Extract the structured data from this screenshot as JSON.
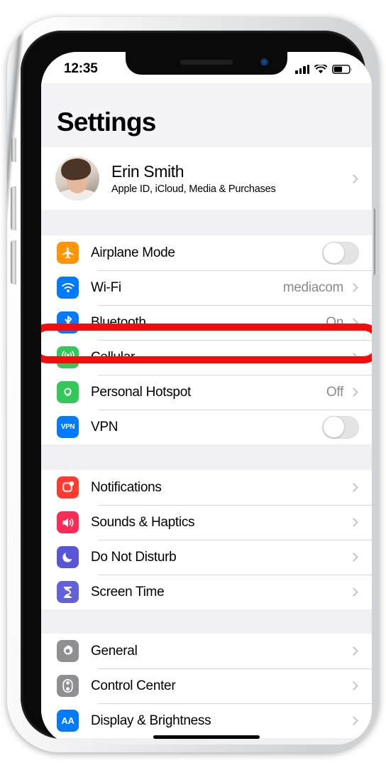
{
  "status_bar": {
    "time": "12:35",
    "signal_icon": "cellular-bars-icon",
    "wifi_icon": "wifi-icon",
    "battery_icon": "battery-icon",
    "battery_level_pct": 52
  },
  "header": {
    "title": "Settings"
  },
  "account": {
    "name": "Erin Smith",
    "subtitle": "Apple ID, iCloud, Media & Purchases",
    "avatar_icon": "avatar",
    "chevron_icon": "chevron-right-icon"
  },
  "annotation": {
    "target": "wifi-row",
    "shape": "oval",
    "color": "#f40c0c"
  },
  "groups": [
    {
      "id": "connectivity",
      "rows": [
        {
          "id": "airplane-mode",
          "label": "Airplane Mode",
          "icon": "airplane-icon",
          "icon_color": "#ff9500",
          "accessory": "toggle",
          "toggle_on": false
        },
        {
          "id": "wifi",
          "label": "Wi-Fi",
          "icon": "wifi-icon",
          "icon_color": "#007aff",
          "accessory": "chevron",
          "value": "mediacom",
          "highlighted": true
        },
        {
          "id": "bluetooth",
          "label": "Bluetooth",
          "icon": "bluetooth-icon",
          "icon_color": "#007aff",
          "accessory": "chevron",
          "value": "On"
        },
        {
          "id": "cellular",
          "label": "Cellular",
          "icon": "cellular-icon",
          "icon_color": "#34c759",
          "accessory": "chevron",
          "value": ""
        },
        {
          "id": "personal-hotspot",
          "label": "Personal Hotspot",
          "icon": "hotspot-icon",
          "icon_color": "#34c759",
          "accessory": "chevron",
          "value": "Off"
        },
        {
          "id": "vpn",
          "label": "VPN",
          "icon": "vpn-icon",
          "icon_color": "#007aff",
          "accessory": "toggle",
          "toggle_on": false
        }
      ]
    },
    {
      "id": "alerts",
      "rows": [
        {
          "id": "notifications",
          "label": "Notifications",
          "icon": "notifications-icon",
          "icon_color": "#ff3b30",
          "accessory": "chevron",
          "value": ""
        },
        {
          "id": "sounds-haptics",
          "label": "Sounds & Haptics",
          "icon": "sounds-icon",
          "icon_color": "#fa2b56",
          "accessory": "chevron",
          "value": ""
        },
        {
          "id": "do-not-disturb",
          "label": "Do Not Disturb",
          "icon": "moon-icon",
          "icon_color": "#5856d6",
          "accessory": "chevron",
          "value": ""
        },
        {
          "id": "screen-time",
          "label": "Screen Time",
          "icon": "hourglass-icon",
          "icon_color": "#6360db",
          "accessory": "chevron",
          "value": ""
        }
      ]
    },
    {
      "id": "system",
      "rows": [
        {
          "id": "general",
          "label": "General",
          "icon": "gear-icon",
          "icon_color": "#8e8e93",
          "accessory": "chevron",
          "value": ""
        },
        {
          "id": "control-center",
          "label": "Control Center",
          "icon": "control-center-icon",
          "icon_color": "#8e8e93",
          "accessory": "chevron",
          "value": ""
        },
        {
          "id": "display-brightness",
          "label": "Display & Brightness",
          "icon": "aa-icon",
          "icon_color": "#007aff",
          "accessory": "chevron",
          "value": ""
        }
      ]
    }
  ]
}
